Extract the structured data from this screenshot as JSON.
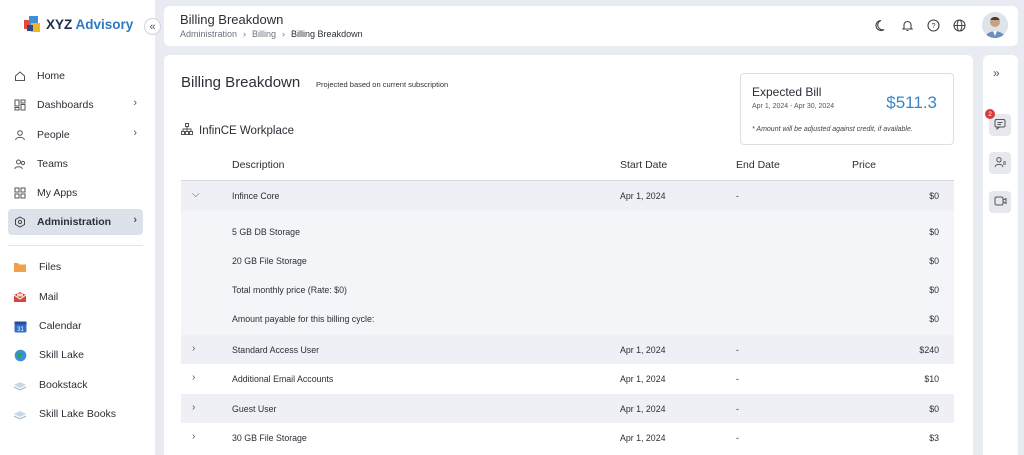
{
  "brand": {
    "name_part1": "XYZ",
    "name_part2": "Advisory",
    "colors": [
      "#e8483c",
      "#3f8ed8",
      "#f0b429",
      "#2b4a86"
    ]
  },
  "sidebar": {
    "nav": [
      {
        "label": "Home",
        "icon": "home-icon",
        "has_chevron": false,
        "active": false
      },
      {
        "label": "Dashboards",
        "icon": "dashboard-icon",
        "has_chevron": true,
        "active": false
      },
      {
        "label": "People",
        "icon": "person-icon",
        "has_chevron": true,
        "active": false
      },
      {
        "label": "Teams",
        "icon": "team-icon",
        "has_chevron": false,
        "active": false
      },
      {
        "label": "My Apps",
        "icon": "apps-icon",
        "has_chevron": false,
        "active": false
      },
      {
        "label": "Administration",
        "icon": "admin-settings-icon",
        "has_chevron": true,
        "active": true
      }
    ],
    "apps": [
      {
        "label": "Files",
        "icon": "folder-icon"
      },
      {
        "label": "Mail",
        "icon": "mail-icon"
      },
      {
        "label": "Calendar",
        "icon": "calendar-icon"
      },
      {
        "label": "Skill Lake",
        "icon": "globe-icon"
      },
      {
        "label": "Bookstack",
        "icon": "bookstack-icon"
      },
      {
        "label": "Skill Lake Books",
        "icon": "books-icon"
      }
    ],
    "calendar_day": "31"
  },
  "header": {
    "title": "Billing Breakdown",
    "breadcrumbs": [
      "Administration",
      "Billing",
      "Billing Breakdown"
    ],
    "icons": [
      "moon-icon",
      "bell-icon",
      "help-icon",
      "globe-icon",
      "avatar"
    ]
  },
  "main": {
    "title": "Billing Breakdown",
    "subtitle": "Projected based on current subscription",
    "workspace": "InfinCE Workplace",
    "bill": {
      "title": "Expected Bill",
      "range": "Apr 1, 2024 - Apr 30, 2024",
      "amount": "$511.3",
      "note": "* Amount will be adjusted against credit, if available."
    },
    "table": {
      "headers": [
        "Description",
        "Start Date",
        "End Date",
        "Price"
      ],
      "expanded": {
        "description": "Infince Core",
        "start": "Apr 1, 2024",
        "end": "-",
        "price": "$0",
        "details": [
          {
            "description": "5 GB DB Storage",
            "price": "$0"
          },
          {
            "description": "20 GB File Storage",
            "price": "$0"
          },
          {
            "description": "Total monthly price (Rate: $0)",
            "price": "$0"
          },
          {
            "description": "Amount payable for this billing cycle:",
            "price": "$0"
          }
        ]
      },
      "rows": [
        {
          "description": "Standard Access User",
          "start": "Apr 1, 2024",
          "end": "-",
          "price": "$240"
        },
        {
          "description": "Additional Email Accounts",
          "start": "Apr 1, 2024",
          "end": "-",
          "price": "$10"
        },
        {
          "description": "Guest User",
          "start": "Apr 1, 2024",
          "end": "-",
          "price": "$0"
        },
        {
          "description": "30 GB File Storage",
          "start": "Apr 1, 2024",
          "end": "-",
          "price": "$3"
        }
      ]
    }
  },
  "rail": {
    "badge_count": "2",
    "icons": [
      "expand-icon",
      "chat-icon",
      "people-icon",
      "meeting-icon"
    ]
  }
}
